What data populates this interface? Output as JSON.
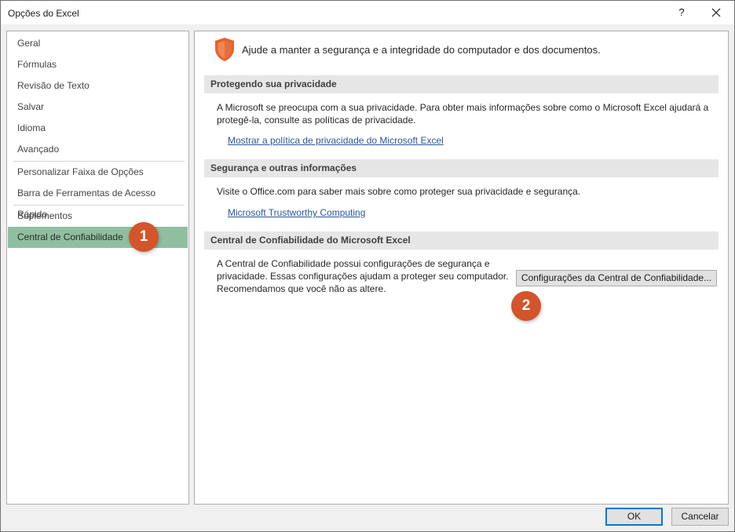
{
  "window": {
    "title": "Opções do Excel",
    "help_label": "?"
  },
  "sidebar": {
    "items": [
      {
        "label": "Geral"
      },
      {
        "label": "Fórmulas"
      },
      {
        "label": "Revisão de Texto"
      },
      {
        "label": "Salvar"
      },
      {
        "label": "Idioma"
      },
      {
        "label": "Avançado"
      },
      {
        "label": "Personalizar Faixa de Opções"
      },
      {
        "label": "Barra de Ferramentas de Acesso Rápido"
      },
      {
        "label": "Suplementos"
      },
      {
        "label": "Central de Confiabilidade",
        "selected": true
      }
    ]
  },
  "content": {
    "intro": "Ajude a manter a segurança e a integridade do computador e dos documentos.",
    "intro_icon": "shield-icon",
    "sections": [
      {
        "header": "Protegendo sua privacidade",
        "text_lines": [
          "A Microsoft se preocupa com a sua privacidade. Para obter mais informações sobre como o Microsoft Excel ajudará a",
          "protegê-la, consulte as políticas de privacidade."
        ],
        "link": "Mostrar a política de privacidade do Microsoft Excel"
      },
      {
        "header": "Segurança e outras informações",
        "text_lines": [
          "Visite o Office.com para saber mais sobre como proteger sua privacidade e segurança."
        ],
        "link": "Microsoft Trustworthy Computing"
      },
      {
        "header": "Central de Confiabilidade do Microsoft Excel",
        "text_lines": [
          "A Central de Confiabilidade possui configurações de segurança e",
          "privacidade. Essas configurações ajudam a proteger seu computador.",
          "Recomendamos que você não as altere."
        ],
        "button": "Configurações da Central de Confiabilidade..."
      }
    ]
  },
  "footer": {
    "ok": "OK",
    "cancel": "Cancelar"
  },
  "markers": [
    "1",
    "2"
  ],
  "colors": {
    "selected_nav": "#8fbf9f",
    "marker": "#d4542b",
    "shield": "#e8632b",
    "link": "#2b579a",
    "primary_border": "#0078d7"
  }
}
